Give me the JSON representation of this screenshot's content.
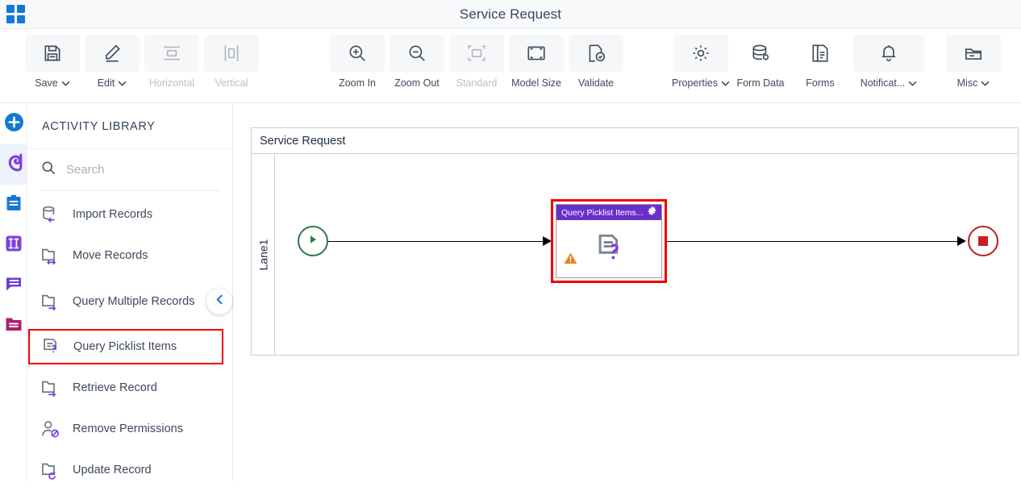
{
  "window": {
    "title": "Service Request",
    "app_menu_icon": "grid-icon"
  },
  "toolbar": {
    "groups": [
      {
        "items": [
          {
            "label": "Save",
            "icon": "save-icon",
            "caret": true,
            "disabled": false
          },
          {
            "label": "Edit",
            "icon": "edit-pencil-icon",
            "caret": true,
            "disabled": false
          },
          {
            "label": "Horizontal",
            "icon": "horizontal-align-icon",
            "caret": false,
            "disabled": true
          },
          {
            "label": "Vertical",
            "icon": "vertical-align-icon",
            "caret": false,
            "disabled": true
          }
        ]
      },
      {
        "items": [
          {
            "label": "Zoom In",
            "icon": "zoom-in-icon",
            "caret": false,
            "disabled": false
          },
          {
            "label": "Zoom Out",
            "icon": "zoom-out-icon",
            "caret": false,
            "disabled": false
          },
          {
            "label": "Standard",
            "icon": "standard-size-icon",
            "caret": false,
            "disabled": true
          },
          {
            "label": "Model Size",
            "icon": "model-size-icon",
            "caret": false,
            "disabled": false
          },
          {
            "label": "Validate",
            "icon": "validate-icon",
            "caret": false,
            "disabled": false
          }
        ]
      },
      {
        "items": [
          {
            "label": "Properties",
            "icon": "gear-icon",
            "caret": true,
            "disabled": false
          },
          {
            "label": "Form Data",
            "icon": "database-icon",
            "caret": false,
            "disabled": false
          },
          {
            "label": "Forms",
            "icon": "forms-document-icon",
            "caret": false,
            "disabled": false
          },
          {
            "label": "Notificat...",
            "icon": "bell-icon",
            "caret": true,
            "disabled": false
          },
          {
            "label": "Misc",
            "icon": "folder-misc-icon",
            "caret": true,
            "disabled": false
          }
        ]
      }
    ]
  },
  "rail": {
    "items": [
      {
        "name": "add-button",
        "icon": "plus-circle-icon",
        "color": "#1578d3",
        "active": false
      },
      {
        "name": "activities",
        "icon": "swirl-icon",
        "color": "#7b3fe4",
        "active": true
      },
      {
        "name": "forms",
        "icon": "clipboard-icon",
        "color": "#1578d3",
        "active": false
      },
      {
        "name": "columns",
        "icon": "columns-icon",
        "color": "#7b3fe4",
        "active": false
      },
      {
        "name": "messages",
        "icon": "chat-icon",
        "color": "#6a3fd4",
        "active": false
      },
      {
        "name": "data",
        "icon": "folder-data-icon",
        "color": "#b01d71",
        "active": false
      }
    ]
  },
  "library": {
    "title": "ACTIVITY LIBRARY",
    "search": {
      "value": "",
      "placeholder": "Search",
      "icon": "search-icon"
    },
    "collapse_icon": "chevron-left-icon",
    "items": [
      {
        "label": "Import Records",
        "icon": "import-records-icon",
        "highlighted": false,
        "tall": false
      },
      {
        "label": "Move Records",
        "icon": "move-records-icon",
        "highlighted": false,
        "tall": false
      },
      {
        "label": "Query Multiple Records",
        "icon": "query-multiple-records-icon",
        "highlighted": false,
        "tall": true
      },
      {
        "label": "Query Picklist Items",
        "icon": "query-picklist-items-icon",
        "highlighted": true,
        "tall": false
      },
      {
        "label": "Retrieve Record",
        "icon": "retrieve-record-icon",
        "highlighted": false,
        "tall": false
      },
      {
        "label": "Remove Permissions",
        "icon": "remove-permissions-icon",
        "highlighted": false,
        "tall": false
      },
      {
        "label": "Update Record",
        "icon": "update-record-icon",
        "highlighted": false,
        "tall": false
      }
    ]
  },
  "diagram": {
    "pool_title": "Service Request",
    "lane_label": "Lane1",
    "start_node": {
      "name": "start-event",
      "icon": "play-icon",
      "color": "#2b7a4b"
    },
    "end_node": {
      "name": "end-event",
      "icon": "stop-square-icon",
      "color": "#b52222"
    },
    "task": {
      "title": "Query Picklist Items...",
      "header_color": "#6a2fc9",
      "selection_color": "#f00000",
      "gear_icon": "gear-icon",
      "warning_icon": "warning-triangle-icon",
      "body_icon": "query-picklist-items-icon",
      "selected": true
    }
  }
}
